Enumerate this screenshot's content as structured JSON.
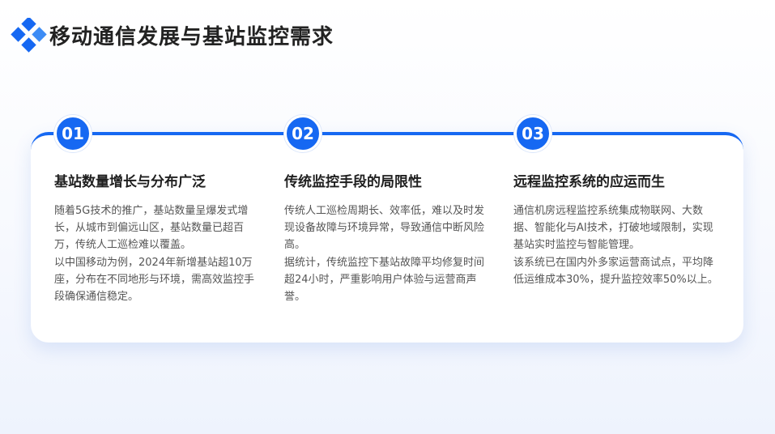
{
  "page": {
    "title": "移动通信发展与基站监控需求"
  },
  "colors": {
    "accent": "#1668f2",
    "accent_light": "#3d8cf5",
    "title_text": "#222222",
    "body_text": "#555555"
  },
  "sections": [
    {
      "number": "01",
      "title": "基站数量增长与分布广泛",
      "paragraphs": [
        "随着5G技术的推广，基站数量呈爆发式增长，从城市到偏远山区，基站数量已超百万，传统人工巡检难以覆盖。",
        "以中国移动为例，2024年新增基站超10万座，分布在不同地形与环境，需高效监控手段确保通信稳定。"
      ]
    },
    {
      "number": "02",
      "title": "传统监控手段的局限性",
      "paragraphs": [
        "传统人工巡检周期长、效率低，难以及时发现设备故障与环境异常，导致通信中断风险高。",
        "据统计，传统监控下基站故障平均修复时间超24小时，严重影响用户体验与运营商声誉。"
      ]
    },
    {
      "number": "03",
      "title": "远程监控系统的应运而生",
      "paragraphs": [
        "通信机房远程监控系统集成物联网、大数据、智能化与AI技术，打破地域限制，实现基站实时监控与智能管理。",
        "该系统已在国内外多家运营商试点，平均降低运维成本30%，提升监控效率50%以上。"
      ]
    }
  ]
}
